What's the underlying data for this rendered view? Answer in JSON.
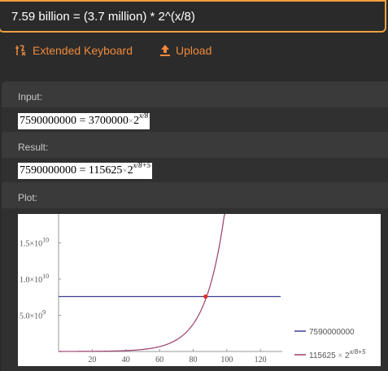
{
  "query": {
    "text": "7.59 billion = (3.7 million) * 2^(x/8)"
  },
  "toolbar": {
    "extended_keyboard_label": "Extended Keyboard",
    "upload_label": "Upload"
  },
  "input": {
    "title": "Input:",
    "lhs": "7590000000",
    "eq": "=",
    "coef": "3700000",
    "times": "×",
    "base": "2",
    "exponent": "x/8"
  },
  "result": {
    "title": "Result:",
    "lhs": "7590000000",
    "eq": "=",
    "coef": "115625",
    "times": "×",
    "base": "2",
    "exponent": "x/8+5"
  },
  "plot": {
    "title": "Plot:",
    "legend": {
      "series1": "7590000000",
      "series2_coef": "115625",
      "series2_times": "×",
      "series2_base": "2",
      "series2_exp": "x/8+5"
    }
  },
  "chart_data": {
    "type": "line",
    "x_ticks": [
      "20",
      "40",
      "60",
      "80",
      "100",
      "120"
    ],
    "y_ticks": [
      {
        "mant": "5.0×10",
        "exp": "9",
        "value": 5000000000
      },
      {
        "mant": "1.0×10",
        "exp": "10",
        "value": 10000000000
      },
      {
        "mant": "1.5×10",
        "exp": "10",
        "value": 15000000000
      }
    ],
    "xlim": [
      0,
      132
    ],
    "ylim": [
      0,
      19000000000
    ],
    "series": [
      {
        "name": "7590000000",
        "type": "constant",
        "value": 7590000000,
        "color": "#3f3f8f"
      },
      {
        "name": "115625×2^(x/8+5)",
        "type": "exponential",
        "coef": 115625,
        "base": 2,
        "exp_scale": 8,
        "exp_offset": 5,
        "color": "#9b3f6c"
      }
    ],
    "intersection": {
      "x": 87.4,
      "y": 7590000000,
      "color": "#e03020"
    },
    "grid": false
  },
  "colors": {
    "accent": "#f08a3c",
    "query_border": "#f0a040"
  }
}
